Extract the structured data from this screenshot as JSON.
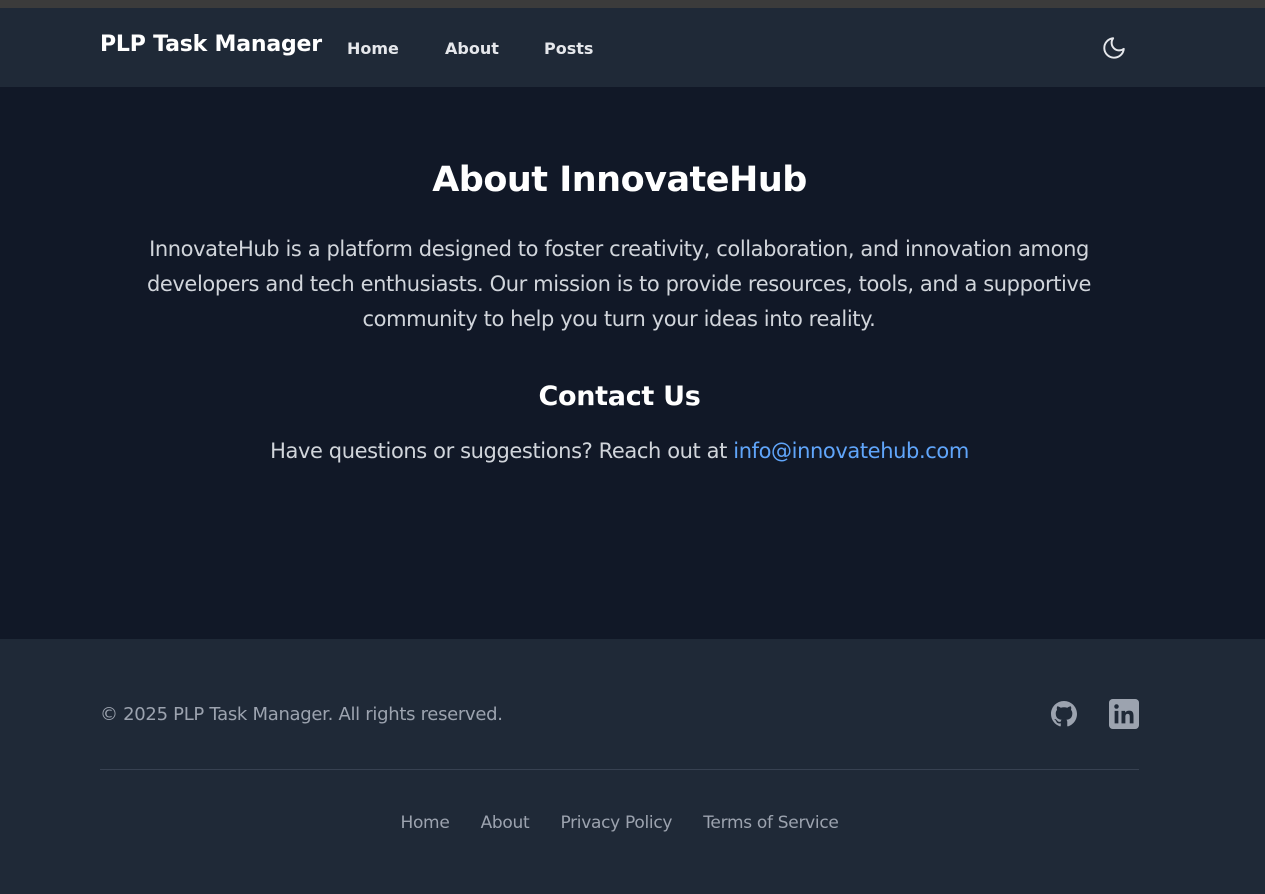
{
  "navbar": {
    "brand": "PLP Task Manager",
    "links": [
      {
        "label": "Home"
      },
      {
        "label": "About"
      },
      {
        "label": "Posts"
      }
    ],
    "theme_icon": "moon-icon"
  },
  "about": {
    "title": "About InnovateHub",
    "text": "InnovateHub is a platform designed to foster creativity, collaboration, and innovation among developers and tech enthusiasts. Our mission is to provide resources, tools, and a supportive community to help you turn your ideas into reality."
  },
  "contact": {
    "title": "Contact Us",
    "text": "Have questions or suggestions? Reach out at",
    "email": "info@innovatehub.com"
  },
  "footer": {
    "copyright": "© 2025 PLP Task Manager. All rights reserved.",
    "social": [
      "github-icon",
      "linkedin-icon"
    ],
    "links": [
      {
        "label": "Home"
      },
      {
        "label": "About"
      },
      {
        "label": "Privacy Policy"
      },
      {
        "label": "Terms of Service"
      }
    ]
  },
  "colors": {
    "page_bg": "#111827",
    "nav_bg": "#1f2937",
    "link_accent": "#60a5fa"
  }
}
